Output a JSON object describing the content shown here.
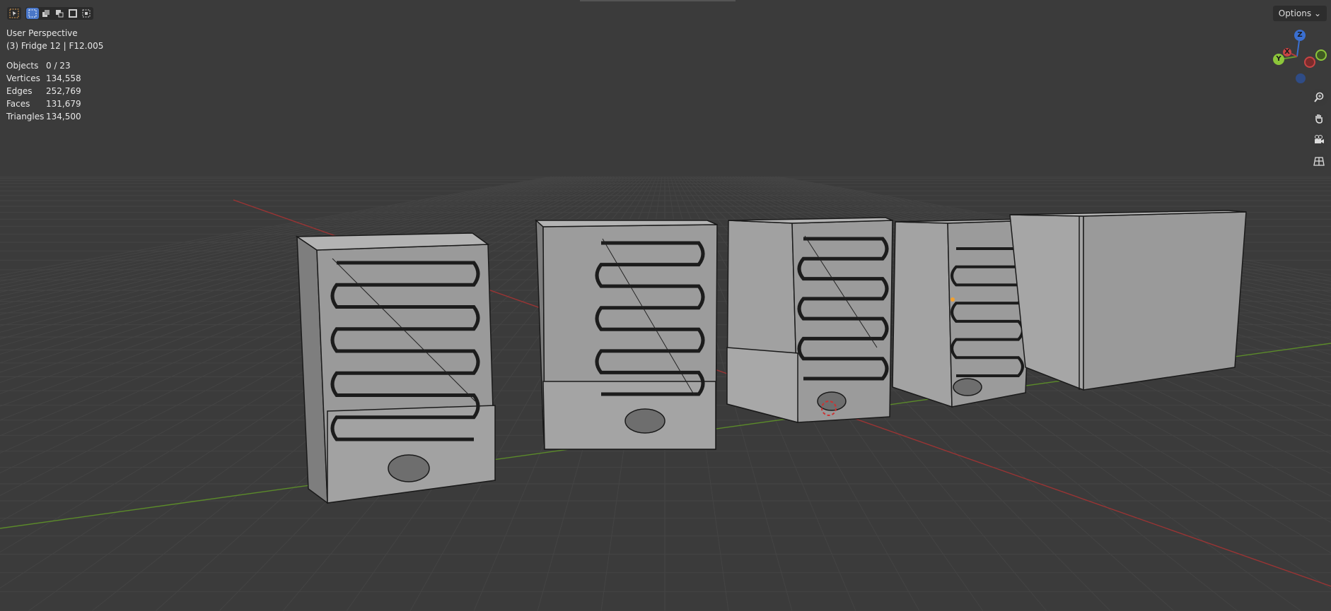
{
  "viewport": {
    "view_name": "User Perspective",
    "object_name": "(3) Fridge 12 | F12.005"
  },
  "stats": {
    "objects": {
      "label": "Objects",
      "value": "0 / 23"
    },
    "vertices": {
      "label": "Vertices",
      "value": "134,558"
    },
    "edges": {
      "label": "Edges",
      "value": "252,769"
    },
    "faces": {
      "label": "Faces",
      "value": "131,679"
    },
    "triangles": {
      "label": "Triangles",
      "value": "134,500"
    }
  },
  "header": {
    "options_label": "Options",
    "options_chevron": "⌄"
  },
  "gizmo": {
    "z_label": "Z",
    "y_label": "Y",
    "x_label": "X"
  },
  "icons": [
    "select-tool-icon",
    "select-mode-icons",
    "zoom-icon",
    "hand-pan-icon",
    "camera-icon",
    "grid-icon"
  ],
  "colors": {
    "background": "#3b3b3b",
    "x_axis": "#b33a3a",
    "y_axis": "#6b9a2e",
    "z_axis": "#3a6fd0",
    "active": "#4a77c9"
  }
}
